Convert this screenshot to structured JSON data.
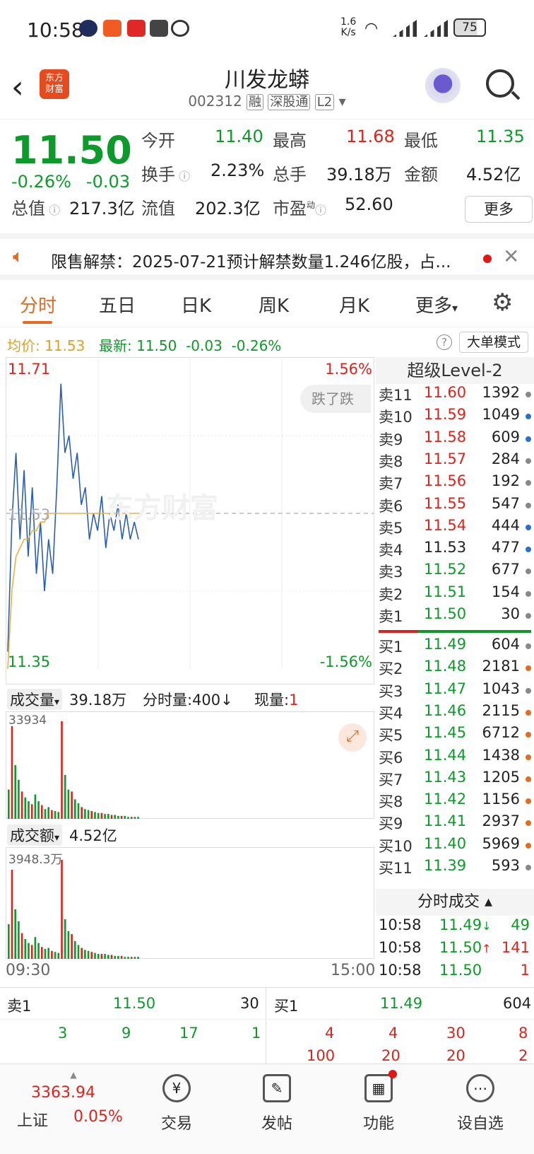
{
  "status": {
    "time": "10:58",
    "speed_value": "1.6",
    "speed_unit": "K/s",
    "battery": "75"
  },
  "header": {
    "logo_line1": "东方",
    "logo_line2": "财富",
    "title": "川发龙蟒",
    "code": "002312",
    "tags": [
      "融",
      "深股通",
      "L2"
    ]
  },
  "quote": {
    "price": "11.50",
    "change_pct": "-0.26%",
    "change_abs": "-0.03",
    "open_label": "今开",
    "open": "11.40",
    "high_label": "最高",
    "high": "11.68",
    "low_label": "最低",
    "low": "11.35",
    "turnover_label": "换手",
    "turnover": "2.23%",
    "volume_label": "总手",
    "volume": "39.18万",
    "amount_label": "金额",
    "amount": "4.52亿",
    "mktcap_label": "总值",
    "mktcap": "217.3亿",
    "float_label": "流值",
    "float_cap": "202.3亿",
    "pe_label": "市盈",
    "pe_sup": "动",
    "pe": "52.60",
    "more_label": "更多"
  },
  "notice": {
    "text": "限售解禁：2025-07-21预计解禁数量1.246亿股，占..."
  },
  "tabs": [
    "分时",
    "五日",
    "日K",
    "周K",
    "月K",
    "更多"
  ],
  "avgbar": {
    "avg_label": "均价:",
    "avg": "11.53",
    "latest_label": "最新:",
    "latest": "11.50",
    "latest_chg": "-0.03",
    "latest_pct": "-0.26%",
    "mode_label": "大单模式"
  },
  "chart": {
    "top_price": "11.71",
    "top_pct": "1.56%",
    "mid_price": "11.53",
    "bot_price": "11.35",
    "bot_pct": "-1.56%",
    "popup": "跌了跌",
    "watermark": "东方财富",
    "vol_label": "成交量",
    "vol_value": "39.18万",
    "tick_label": "分时量:400",
    "tick_arrow": "↓",
    "cur_label": "现量:",
    "cur_value": "1",
    "vol_max": "33934",
    "amt_label": "成交额",
    "amt_value": "4.52亿",
    "amt_max": "3948.3万",
    "time_start": "09:30",
    "time_end": "15:00"
  },
  "chart_data": {
    "type": "line",
    "ylim": [
      11.35,
      11.71
    ],
    "series": [
      {
        "values": [
          11.37,
          11.52,
          11.6,
          11.5,
          11.58,
          11.48,
          11.56,
          11.46,
          11.52,
          11.44,
          11.5,
          11.46,
          11.56,
          11.68,
          11.6,
          11.62,
          11.57,
          11.6,
          11.54,
          11.56,
          11.5,
          11.53,
          11.51,
          11.55,
          11.49,
          11.53,
          11.51,
          11.54,
          11.5,
          11.53,
          11.5,
          11.52,
          11.5
        ]
      },
      {
        "values": [
          11.35,
          11.44,
          11.48,
          11.49,
          11.5,
          11.5,
          11.51,
          11.51,
          11.52,
          11.52,
          11.53,
          11.53,
          11.53,
          11.53,
          11.53,
          11.53,
          11.53,
          11.53,
          11.53,
          11.53,
          11.53,
          11.53,
          11.53,
          11.53,
          11.53,
          11.53,
          11.53,
          11.53,
          11.53,
          11.53,
          11.53,
          11.53,
          11.53
        ]
      }
    ],
    "volume": [
      30,
      95,
      55,
      40,
      28,
      22,
      18,
      15,
      25,
      18,
      14,
      10,
      12,
      9,
      8,
      7,
      100,
      45,
      30,
      28,
      20,
      16,
      12,
      10,
      9,
      8,
      7,
      6,
      6,
      5,
      5,
      4,
      4,
      3,
      3,
      3,
      2,
      2,
      2,
      2
    ],
    "amount": [
      35,
      90,
      50,
      38,
      26,
      20,
      16,
      14,
      22,
      16,
      12,
      10,
      11,
      8,
      7,
      6,
      100,
      40,
      28,
      25,
      18,
      14,
      11,
      9,
      8,
      7,
      6,
      5,
      5,
      5,
      4,
      4,
      3,
      3,
      3,
      2,
      2,
      2,
      2,
      2
    ]
  },
  "level2": {
    "title": "超级Level-2",
    "asks": [
      {
        "name": "卖11",
        "price": "11.60",
        "qty": "1392",
        "dot": "#888888"
      },
      {
        "name": "卖10",
        "price": "11.59",
        "qty": "1049",
        "dot": "#2a6fd0"
      },
      {
        "name": "卖9",
        "price": "11.58",
        "qty": "609",
        "dot": "#2a6fd0"
      },
      {
        "name": "卖8",
        "price": "11.57",
        "qty": "284",
        "dot": "#888888"
      },
      {
        "name": "卖7",
        "price": "11.56",
        "qty": "192",
        "dot": "#888888"
      },
      {
        "name": "卖6",
        "price": "11.55",
        "qty": "547",
        "dot": "#888888"
      },
      {
        "name": "卖5",
        "price": "11.54",
        "qty": "444",
        "dot": "#2a6fd0"
      },
      {
        "name": "卖4",
        "price": "11.53",
        "qty": "477",
        "dot": "#2a6fd0"
      },
      {
        "name": "卖3",
        "price": "11.52",
        "qty": "677",
        "dot": "#888888"
      },
      {
        "name": "卖2",
        "price": "11.51",
        "qty": "154",
        "dot": "#888888"
      },
      {
        "name": "卖1",
        "price": "11.50",
        "qty": "30",
        "dot": "#888888"
      }
    ],
    "bids": [
      {
        "name": "买1",
        "price": "11.49",
        "qty": "604",
        "dot": "#888888"
      },
      {
        "name": "买2",
        "price": "11.48",
        "qty": "2181",
        "dot": "#e66a1f"
      },
      {
        "name": "买3",
        "price": "11.47",
        "qty": "1043",
        "dot": "#888888"
      },
      {
        "name": "买4",
        "price": "11.46",
        "qty": "2115",
        "dot": "#e66a1f"
      },
      {
        "name": "买5",
        "price": "11.45",
        "qty": "6712",
        "dot": "#e66a1f"
      },
      {
        "name": "买6",
        "price": "11.44",
        "qty": "1438",
        "dot": "#e66a1f"
      },
      {
        "name": "买7",
        "price": "11.43",
        "qty": "1205",
        "dot": "#e66a1f"
      },
      {
        "name": "买8",
        "price": "11.42",
        "qty": "1156",
        "dot": "#e66a1f"
      },
      {
        "name": "买9",
        "price": "11.41",
        "qty": "2937",
        "dot": "#e66a1f"
      },
      {
        "name": "买10",
        "price": "11.40",
        "qty": "5969",
        "dot": "#e66a1f"
      },
      {
        "name": "买11",
        "price": "11.39",
        "qty": "593",
        "dot": "#888888"
      }
    ],
    "trades_title": "分时成交",
    "trades": [
      {
        "time": "10:58",
        "price": "11.49",
        "arrow": "↓",
        "qty": "49",
        "qty_color": "#0d9a2a"
      },
      {
        "time": "10:58",
        "price": "11.50",
        "arrow": "↑",
        "qty": "141",
        "qty_color": "#d9251d"
      },
      {
        "time": "10:58",
        "price": "11.50",
        "arrow": "",
        "qty": "1",
        "qty_color": "#d9251d"
      }
    ]
  },
  "bottom_book": {
    "sell_label": "卖1",
    "sell_price": "11.50",
    "sell_qty": "30",
    "buy_label": "买1",
    "buy_price": "11.49",
    "buy_qty": "604",
    "sell_row1": [
      "3",
      "9",
      "17",
      "1"
    ],
    "buy_row1": [
      "4",
      "4",
      "30",
      "8"
    ],
    "buy_row2": [
      "100",
      "20",
      "20",
      "2"
    ]
  },
  "nav": {
    "index_value": "3363.94",
    "index_name": "上证",
    "index_pct": "0.05%",
    "items": [
      {
        "label": "交易",
        "icon": "¥"
      },
      {
        "label": "发帖",
        "icon": "✎"
      },
      {
        "label": "功能",
        "icon": "▦"
      },
      {
        "label": "设自选",
        "icon": "⋯"
      }
    ]
  }
}
